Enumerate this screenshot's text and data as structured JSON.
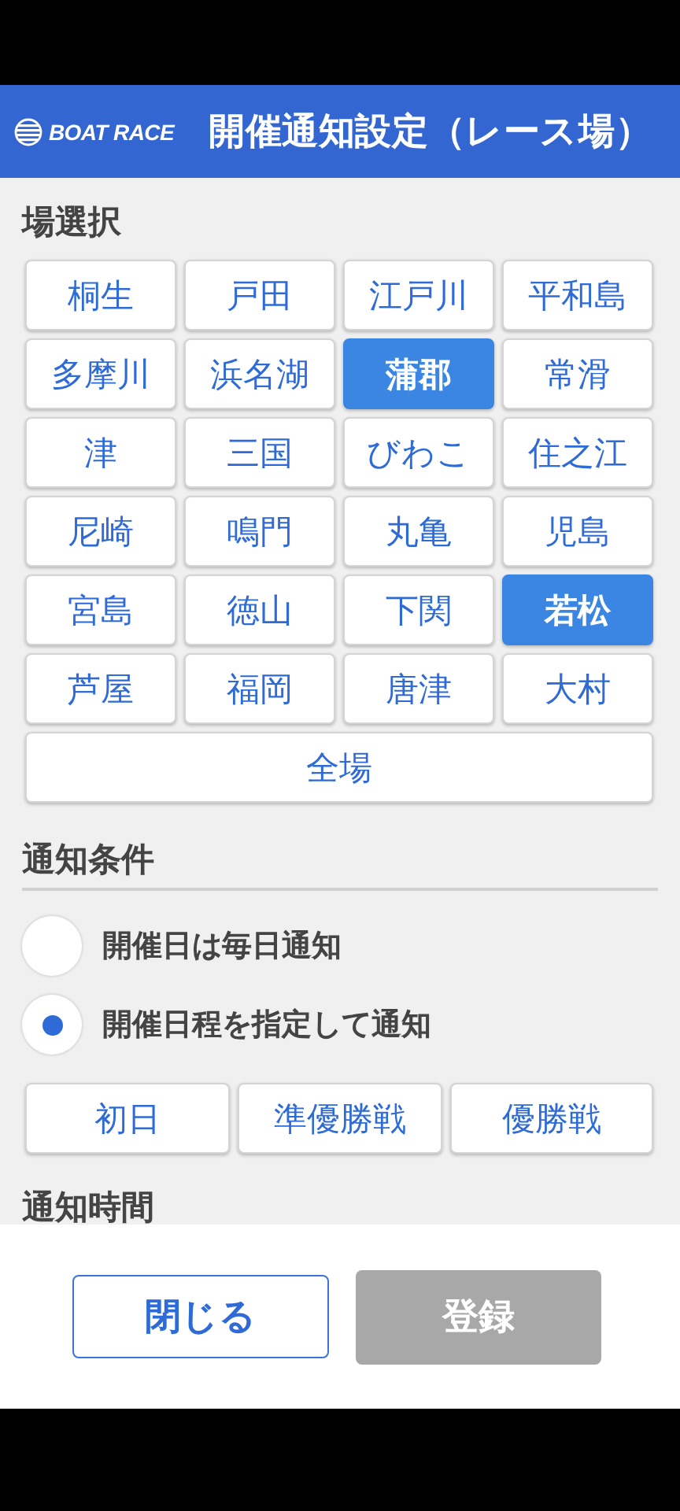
{
  "header": {
    "logo_text": "BOAT RACE",
    "title": "開催通知設定（レース場）"
  },
  "venue_section": {
    "title": "場選択",
    "venues": [
      {
        "label": "桐生",
        "selected": false
      },
      {
        "label": "戸田",
        "selected": false
      },
      {
        "label": "江戸川",
        "selected": false
      },
      {
        "label": "平和島",
        "selected": false
      },
      {
        "label": "多摩川",
        "selected": false
      },
      {
        "label": "浜名湖",
        "selected": false
      },
      {
        "label": "蒲郡",
        "selected": true
      },
      {
        "label": "常滑",
        "selected": false
      },
      {
        "label": "津",
        "selected": false
      },
      {
        "label": "三国",
        "selected": false
      },
      {
        "label": "びわこ",
        "selected": false
      },
      {
        "label": "住之江",
        "selected": false
      },
      {
        "label": "尼崎",
        "selected": false
      },
      {
        "label": "鳴門",
        "selected": false
      },
      {
        "label": "丸亀",
        "selected": false
      },
      {
        "label": "児島",
        "selected": false
      },
      {
        "label": "宮島",
        "selected": false
      },
      {
        "label": "徳山",
        "selected": false
      },
      {
        "label": "下関",
        "selected": false
      },
      {
        "label": "若松",
        "selected": true
      },
      {
        "label": "芦屋",
        "selected": false
      },
      {
        "label": "福岡",
        "selected": false
      },
      {
        "label": "唐津",
        "selected": false
      },
      {
        "label": "大村",
        "selected": false
      }
    ],
    "all_button": {
      "label": "全場",
      "selected": false
    }
  },
  "condition_section": {
    "title": "通知条件",
    "options": [
      {
        "label": "開催日は毎日通知",
        "selected": false
      },
      {
        "label": "開催日程を指定して通知",
        "selected": true
      }
    ],
    "days": [
      {
        "label": "初日",
        "selected": false
      },
      {
        "label": "準優勝戦",
        "selected": false
      },
      {
        "label": "優勝戦",
        "selected": false
      }
    ]
  },
  "time_section": {
    "title": "通知時間"
  },
  "footer": {
    "close_label": "閉じる",
    "register": {
      "label": "登録",
      "disabled": true
    }
  }
}
